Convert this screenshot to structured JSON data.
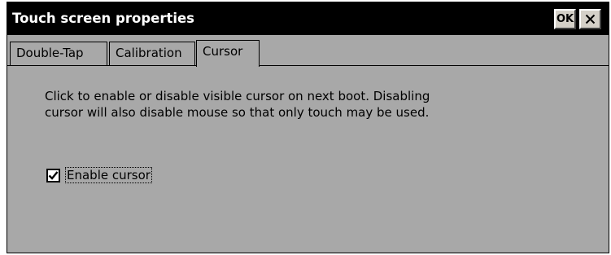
{
  "window": {
    "title": "Touch screen properties",
    "ok_label": "OK",
    "close_icon": "close-icon"
  },
  "tabs": [
    {
      "label": "Double-Tap",
      "active": false
    },
    {
      "label": "Calibration",
      "active": false
    },
    {
      "label": "Cursor",
      "active": true
    }
  ],
  "cursor_page": {
    "description_line1": "Click to enable or disable visible cursor on next boot.  Disabling",
    "description_line2": "cursor will also disable mouse so that only touch may be used.",
    "enable_cursor_label": "Enable cursor",
    "enable_cursor_checked": true
  },
  "colors": {
    "titlebar": "#000000",
    "title_text": "#ffffff",
    "dialog_background": "#a8a8a8",
    "button_face": "#d4d0c8"
  }
}
